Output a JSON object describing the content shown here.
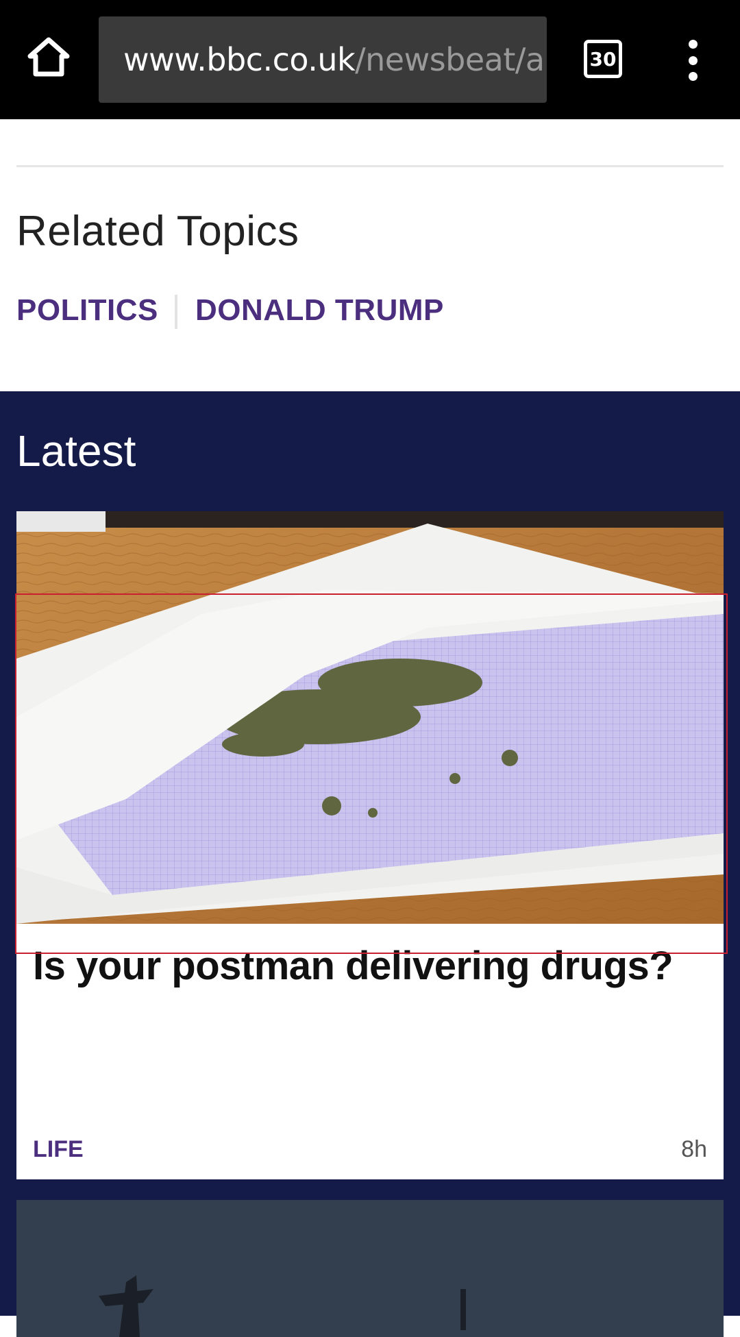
{
  "browser": {
    "url_domain": "www.bbc.co.uk",
    "url_path": "/newsbeat/a",
    "tab_count": "30"
  },
  "related": {
    "heading": "Related Topics",
    "topics": [
      "POLITICS",
      "DONALD TRUMP"
    ]
  },
  "latest": {
    "heading": "Latest",
    "card": {
      "title": "Is your postman delivering drugs?",
      "tag": "LIFE",
      "time": "8h"
    }
  },
  "icons": {
    "home": "home-icon",
    "tabs": "tab-switcher-icon",
    "menu": "overflow-menu-icon",
    "facebook": "facebook-icon",
    "twitter": "twitter-icon",
    "share": "share-icon"
  },
  "colors": {
    "accent": "#4b2e7e",
    "section_bg": "#141b48",
    "topbar_bg": "#000000",
    "highlight": "#c8202f"
  }
}
